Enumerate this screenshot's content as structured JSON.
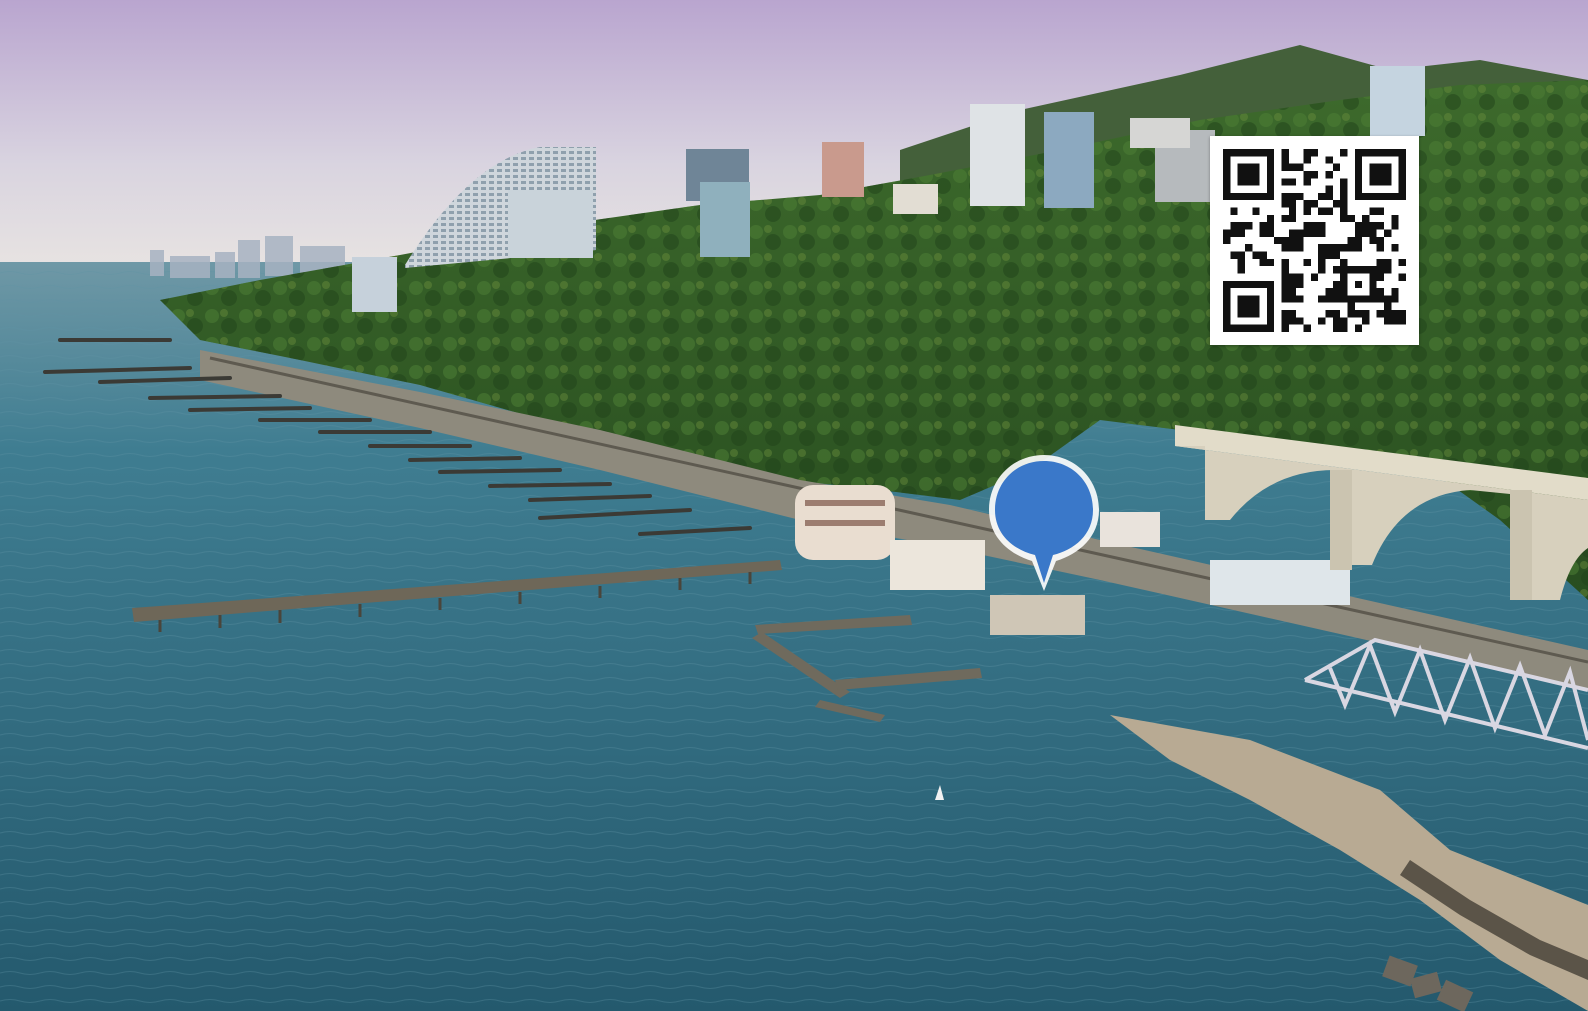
{
  "image": {
    "subject": "aerial-coastal-city",
    "colors": {
      "sea": "#2e6b80",
      "sky_top": "#c3a9d3",
      "sky_horizon": "#e8e2dc",
      "forest": "#2f5a25",
      "bridge": "#e2dcc9",
      "pin": "#3a78c9"
    }
  },
  "overlays": {
    "qr_code": {
      "icon": "qr-code-icon"
    },
    "map_pin": {
      "icon": "map-pin-icon",
      "color": "#3a78c9"
    }
  }
}
